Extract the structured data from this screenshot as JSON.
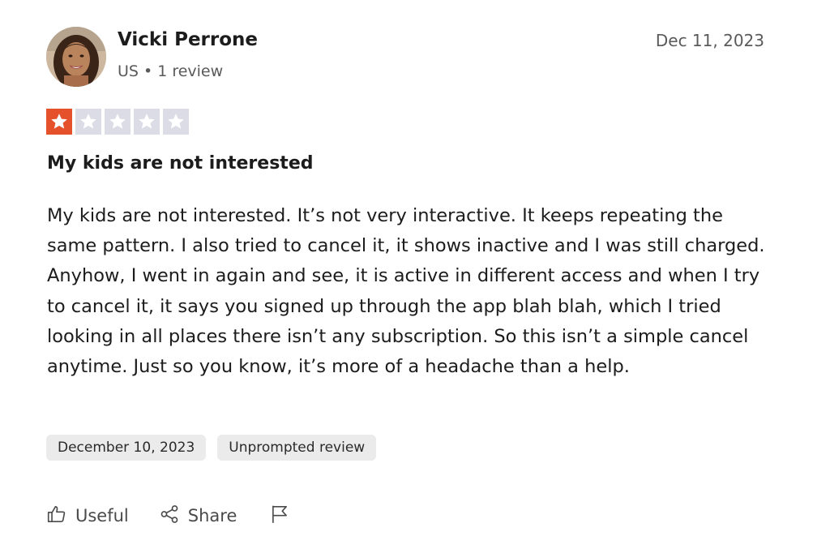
{
  "review": {
    "reviewer": {
      "name": "Vicki Perrone",
      "country": "US",
      "separator": "•",
      "review_count": "1 review"
    },
    "date": "Dec 11, 2023",
    "rating": {
      "value": 1,
      "max": 5,
      "filled_color": "#e5512b",
      "empty_color": "#dcdce6"
    },
    "title": "My kids are not interested",
    "body": "My kids are not interested. It’s not very interactive. It keeps repeating the same pattern. I also tried to cancel it, it shows inactive and I was still charged. Anyhow, I went in again and see, it is active in different access and when I try to cancel it, it says you signed up through the app blah blah, which I tried looking in all places there isn’t any subscription. So this isn’t a simple cancel anytime. Just so you know, it’s more of a headache than a help.",
    "tags": {
      "experience_date": "December 10, 2023",
      "type": "Unprompted review"
    },
    "actions": {
      "useful_label": "Useful",
      "useful_icon": "thumbs-up-icon",
      "share_label": "Share",
      "share_icon": "share-icon",
      "report_icon": "flag-icon"
    }
  }
}
